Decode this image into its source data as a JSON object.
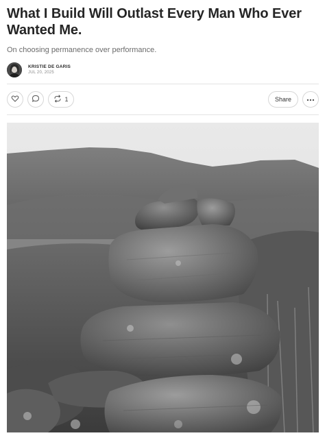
{
  "post": {
    "title": "What I Build Will Outlast Every Man Who Ever Wanted Me.",
    "subtitle": "On choosing permanence over performance.",
    "author": "KRISTIE DE GARIS",
    "date": "JUL 20, 2025"
  },
  "actions": {
    "like_icon": "heart-icon",
    "comment_icon": "comment-icon",
    "restack_icon": "restack-icon",
    "restack_count": "1",
    "share_label": "Share",
    "more_icon": "ellipsis-icon"
  },
  "hero_image": {
    "subject": "stacked-stone-cairn",
    "palette": "grayscale"
  }
}
